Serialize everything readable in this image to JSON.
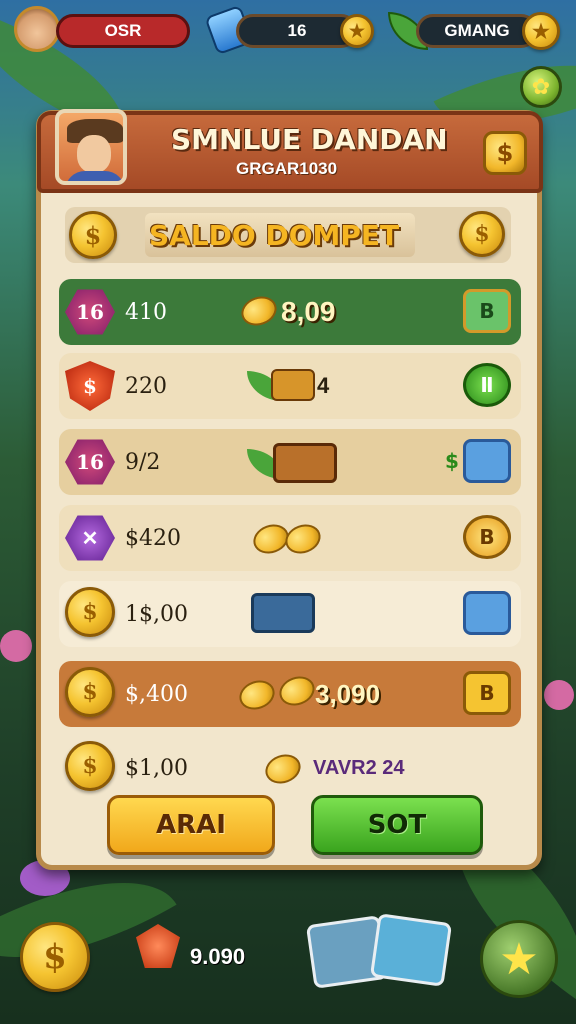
{
  "hud": {
    "player_name": "OSR",
    "gems_value": "16",
    "currency_label": "GMANG"
  },
  "panel": {
    "title": "SMNLUE DANDAN",
    "subtitle": "GRGAR1030",
    "header_badge": "$",
    "wallet_label": "SALDO DOMPET",
    "wallet_coin": "$"
  },
  "rows": [
    {
      "badge": "16",
      "amount": "410",
      "reward": "8,09",
      "icon": "B"
    },
    {
      "badge": "$",
      "amount": "220",
      "reward": "4",
      "icon": "Ⅱ"
    },
    {
      "badge": "16",
      "amount": "9/2",
      "reward": "",
      "icon": "$"
    },
    {
      "badge": "✕",
      "amount": "$420",
      "reward": "",
      "icon": "B"
    },
    {
      "badge": "$",
      "amount": "1$,00",
      "reward": "",
      "icon": ""
    },
    {
      "badge": "$",
      "amount": "$,400",
      "reward": "3,090",
      "icon": "B"
    },
    {
      "badge": "$",
      "amount": "$1,00",
      "reward": "VAVR2 24",
      "icon": ""
    }
  ],
  "buttons": {
    "left": "ARAI",
    "right": "SOT"
  },
  "bottom": {
    "coin_symbol": "$",
    "value": "9.090"
  },
  "colors": {
    "row_green": "#3c7a3a",
    "row_orange": "#c77a3a",
    "row_tan": "#e8d4a8",
    "accent_gold": "#f5b522"
  }
}
